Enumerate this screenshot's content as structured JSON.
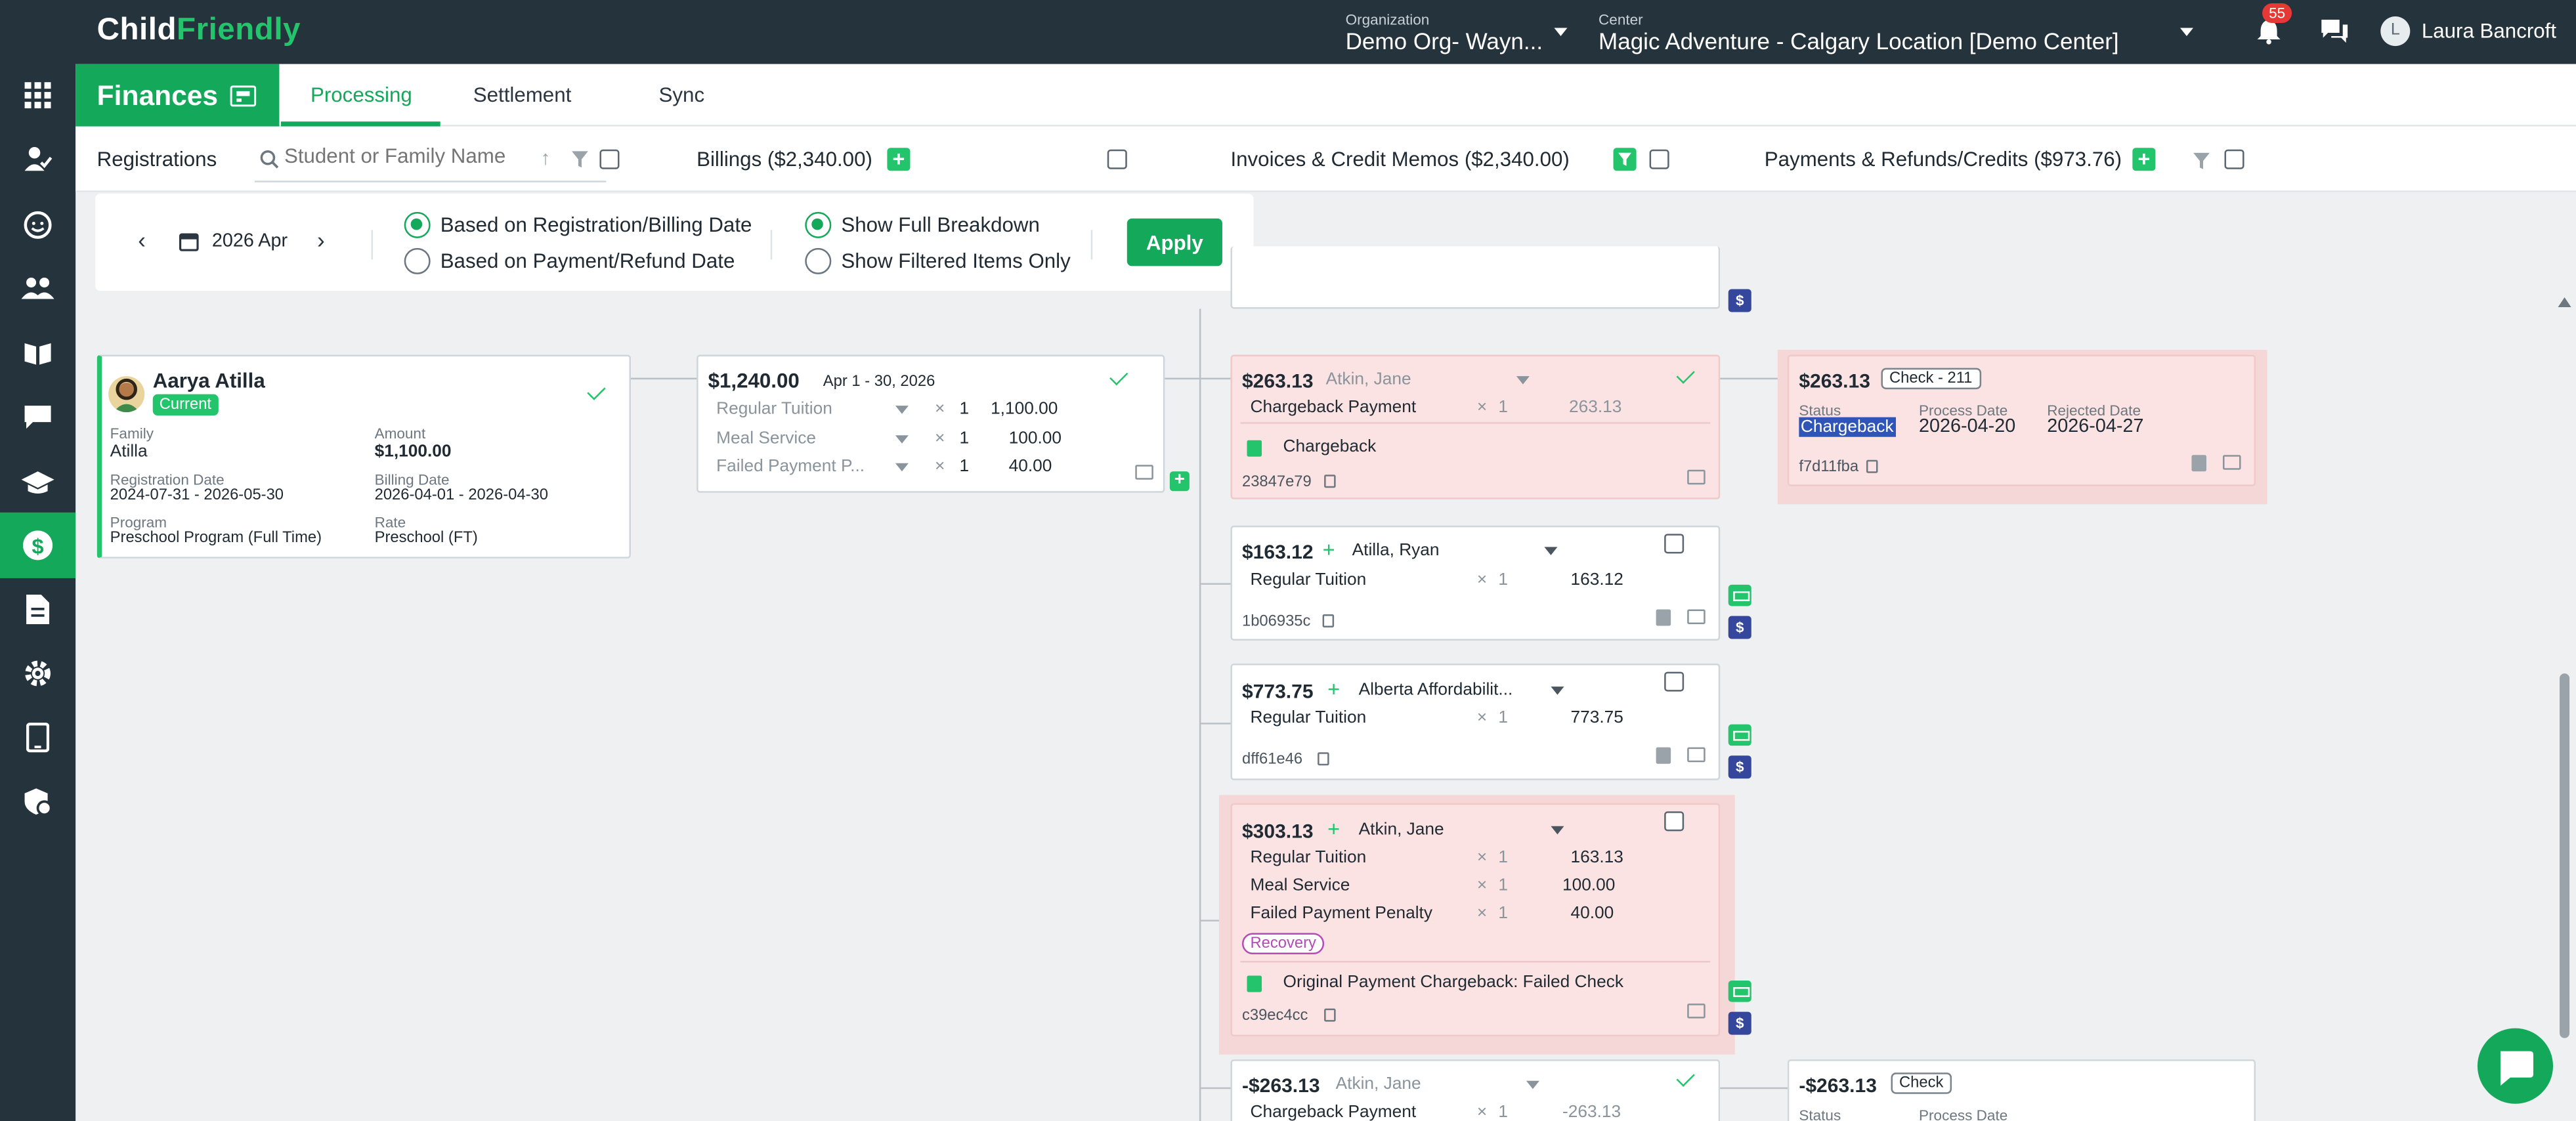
{
  "app": {
    "brand_a": "Child",
    "brand_b": "Friendly",
    "org_label": "Organization",
    "org_value": "Demo Org- Wayn...",
    "center_label": "Center",
    "center_value": "Magic Adventure - Calgary Location [Demo Center]",
    "notifications": "55",
    "user_initial": "L",
    "user_name": "Laura Bancroft"
  },
  "section": {
    "title": "Finances",
    "tabs": [
      "Processing",
      "Settlement",
      "Sync"
    ]
  },
  "filters": {
    "registrations": "Registrations",
    "search_placeholder": "Student or Family Name",
    "billings": "Billings ($2,340.00)",
    "invoices": "Invoices & Credit Memos ($2,340.00)",
    "payments": "Payments & Refunds/Credits ($973.76)"
  },
  "datebar": {
    "month": "2026 Apr",
    "opt1": "Based on Registration/Billing Date",
    "opt2": "Based on Payment/Refund Date",
    "opt3": "Show Full Breakdown",
    "opt4": "Show Filtered Items Only",
    "apply": "Apply"
  },
  "registration": {
    "name": "Aarya Atilla",
    "status": "Current",
    "family_label": "Family",
    "family": "Atilla",
    "amount_label": "Amount",
    "amount": "$1,100.00",
    "reg_date_label": "Registration Date",
    "reg_date": "2024-07-31 - 2026-05-30",
    "billing_date_label": "Billing Date",
    "billing_date": "2026-04-01 - 2026-04-30",
    "program_label": "Program",
    "program": "Preschool Program (Full Time)",
    "rate_label": "Rate",
    "rate": "Preschool (FT)"
  },
  "billing": {
    "amount": "$1,240.00",
    "period": "Apr 1 - 30, 2026",
    "lines": [
      {
        "name": "Regular Tuition",
        "qty": "1",
        "value": "1,100.00"
      },
      {
        "name": "Meal Service",
        "qty": "1",
        "value": "100.00"
      },
      {
        "name": "Failed Payment P...",
        "qty": "1",
        "value": "40.00"
      }
    ]
  },
  "invoices": [
    {
      "amount": "$263.13",
      "who": "Atkin, Jane",
      "line": "Chargeback Payment",
      "qty": "1",
      "value": "263.13",
      "note": "Chargeback",
      "id": "23847e79"
    },
    {
      "amount": "$163.12",
      "who": "Atilla, Ryan",
      "line": "Regular Tuition",
      "qty": "1",
      "value": "163.12",
      "id": "1b06935c"
    },
    {
      "amount": "$773.75",
      "who": "Alberta Affordabilit...",
      "line": "Regular Tuition",
      "qty": "1",
      "value": "773.75",
      "id": "dff61e46"
    },
    {
      "amount": "$303.13",
      "who": "Atkin, Jane",
      "lines": [
        {
          "name": "Regular Tuition",
          "qty": "1",
          "value": "163.13"
        },
        {
          "name": "Meal Service",
          "qty": "1",
          "value": "100.00"
        },
        {
          "name": "Failed Payment Penalty",
          "qty": "1",
          "value": "40.00"
        }
      ],
      "tag": "Recovery",
      "note": "Original Payment Chargeback: Failed Check",
      "id": "c39ec4cc"
    },
    {
      "amount": "-$263.13",
      "who": "Atkin, Jane",
      "line": "Chargeback Payment",
      "qty": "1",
      "value": "-263.13"
    }
  ],
  "payments": [
    {
      "amount": "$263.13",
      "method": "Check - 211",
      "status_label": "Status",
      "status": "Chargeback",
      "process_label": "Process Date",
      "process": "2026-04-20",
      "rejected_label": "Rejected Date",
      "rejected": "2026-04-27",
      "id": "f7d11fba"
    },
    {
      "amount": "-$263.13",
      "method": "Check",
      "status_label": "Status",
      "process_label": "Process Date"
    }
  ],
  "misc": {
    "x": "×",
    "plus": "+",
    "dollar": "$",
    "up": "↑"
  }
}
